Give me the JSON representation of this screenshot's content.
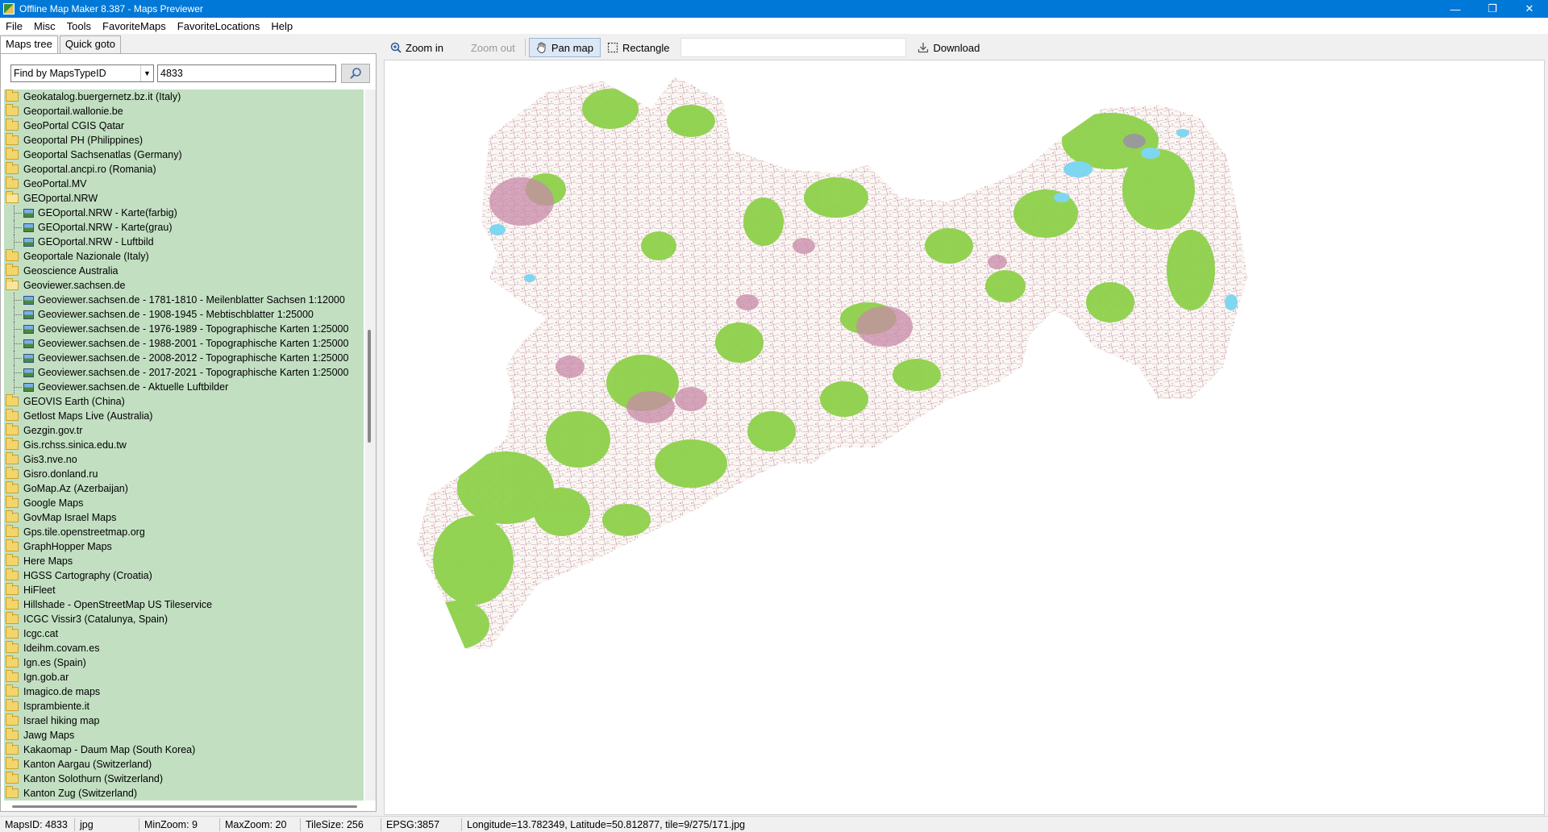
{
  "window": {
    "title": "Offline Map Maker 8.387 - Maps Previewer",
    "minimize": "—",
    "maximize": "❐",
    "close": "✕"
  },
  "menu": [
    "File",
    "Misc",
    "Tools",
    "FavoriteMaps",
    "FavoriteLocations",
    "Help"
  ],
  "tabs": {
    "maps_tree": "Maps tree",
    "quick_goto": "Quick goto"
  },
  "finder": {
    "mode": "Find by MapsTypeID",
    "query": "4833"
  },
  "tree": [
    {
      "label": "Geokatalog.buergernetz.bz.it (Italy)",
      "type": "folder"
    },
    {
      "label": "Geoportail.wallonie.be",
      "type": "folder"
    },
    {
      "label": "GeoPortal CGIS Qatar",
      "type": "folder"
    },
    {
      "label": "Geoportal PH (Philippines)",
      "type": "folder"
    },
    {
      "label": "Geoportal Sachsenatlas (Germany)",
      "type": "folder"
    },
    {
      "label": "Geoportal.ancpi.ro (Romania)",
      "type": "folder"
    },
    {
      "label": "GeoPortal.MV",
      "type": "folder"
    },
    {
      "label": "GEOportal.NRW",
      "type": "folder-open"
    },
    {
      "label": "GEOportal.NRW - Karte(farbig)",
      "type": "map"
    },
    {
      "label": "GEOportal.NRW - Karte(grau)",
      "type": "map"
    },
    {
      "label": "GEOportal.NRW - Luftbild",
      "type": "map"
    },
    {
      "label": "Geoportale Nazionale (Italy)",
      "type": "folder"
    },
    {
      "label": "Geoscience Australia",
      "type": "folder"
    },
    {
      "label": "Geoviewer.sachsen.de",
      "type": "folder-open"
    },
    {
      "label": "Geoviewer.sachsen.de - 1781-1810 - Meilenblatter Sachsen 1:12000",
      "type": "map"
    },
    {
      "label": "Geoviewer.sachsen.de - 1908-1945 - Mebtischblatter 1:25000",
      "type": "map"
    },
    {
      "label": "Geoviewer.sachsen.de - 1976-1989 - Topographische Karten 1:25000",
      "type": "map"
    },
    {
      "label": "Geoviewer.sachsen.de - 1988-2001 - Topographische Karten 1:25000",
      "type": "map"
    },
    {
      "label": "Geoviewer.sachsen.de - 2008-2012 - Topographische Karten 1:25000",
      "type": "map"
    },
    {
      "label": "Geoviewer.sachsen.de - 2017-2021 - Topographische Karten 1:25000",
      "type": "map"
    },
    {
      "label": "Geoviewer.sachsen.de - Aktuelle Luftbilder",
      "type": "map"
    },
    {
      "label": "GEOVIS Earth (China)",
      "type": "folder"
    },
    {
      "label": "Getlost Maps Live (Australia)",
      "type": "folder"
    },
    {
      "label": "Gezgin.gov.tr",
      "type": "folder"
    },
    {
      "label": "Gis.rchss.sinica.edu.tw",
      "type": "folder"
    },
    {
      "label": "Gis3.nve.no",
      "type": "folder"
    },
    {
      "label": "Gisro.donland.ru",
      "type": "folder"
    },
    {
      "label": "GoMap.Az (Azerbaijan)",
      "type": "folder"
    },
    {
      "label": "Google Maps",
      "type": "folder"
    },
    {
      "label": "GovMap Israel Maps",
      "type": "folder"
    },
    {
      "label": "Gps.tile.openstreetmap.org",
      "type": "folder"
    },
    {
      "label": "GraphHopper Maps",
      "type": "folder"
    },
    {
      "label": "Here Maps",
      "type": "folder"
    },
    {
      "label": "HGSS Cartography (Croatia)",
      "type": "folder"
    },
    {
      "label": "HiFleet",
      "type": "folder"
    },
    {
      "label": "Hillshade - OpenStreetMap US Tileservice",
      "type": "folder"
    },
    {
      "label": "ICGC Vissir3 (Catalunya, Spain)",
      "type": "folder"
    },
    {
      "label": "Icgc.cat",
      "type": "folder"
    },
    {
      "label": "Ideihm.covam.es",
      "type": "folder"
    },
    {
      "label": "Ign.es (Spain)",
      "type": "folder"
    },
    {
      "label": "Ign.gob.ar",
      "type": "folder"
    },
    {
      "label": "Imagico.de maps",
      "type": "folder"
    },
    {
      "label": "Isprambiente.it",
      "type": "folder"
    },
    {
      "label": "Israel hiking map",
      "type": "folder"
    },
    {
      "label": "Jawg Maps",
      "type": "folder"
    },
    {
      "label": "Kakaomap - Daum Map (South Korea)",
      "type": "folder"
    },
    {
      "label": "Kanton Aargau (Switzerland)",
      "type": "folder"
    },
    {
      "label": "Kanton Solothurn (Switzerland)",
      "type": "folder"
    },
    {
      "label": "Kanton Zug (Switzerland)",
      "type": "folder"
    }
  ],
  "toolbar": {
    "zoom_in": "Zoom in",
    "zoom_out": "Zoom out",
    "pan_map": "Pan map",
    "rectangle": "Rectangle",
    "download": "Download"
  },
  "status": {
    "maps_id": "MapsID: 4833",
    "format": "jpg",
    "min_zoom": "MinZoom: 9",
    "max_zoom": "MaxZoom: 20",
    "tile_size": "TileSize: 256",
    "epsg": "EPSG:3857",
    "location": "Longitude=13.782349, Latitude=50.812877, tile=9/275/171.jpg"
  },
  "colors": {
    "titlebar": "#0078d7",
    "tree_bg": "#c2dfc2",
    "map_forest": "#8ed14a",
    "map_urban": "#c88aa8",
    "map_water": "#7fd6f0"
  }
}
